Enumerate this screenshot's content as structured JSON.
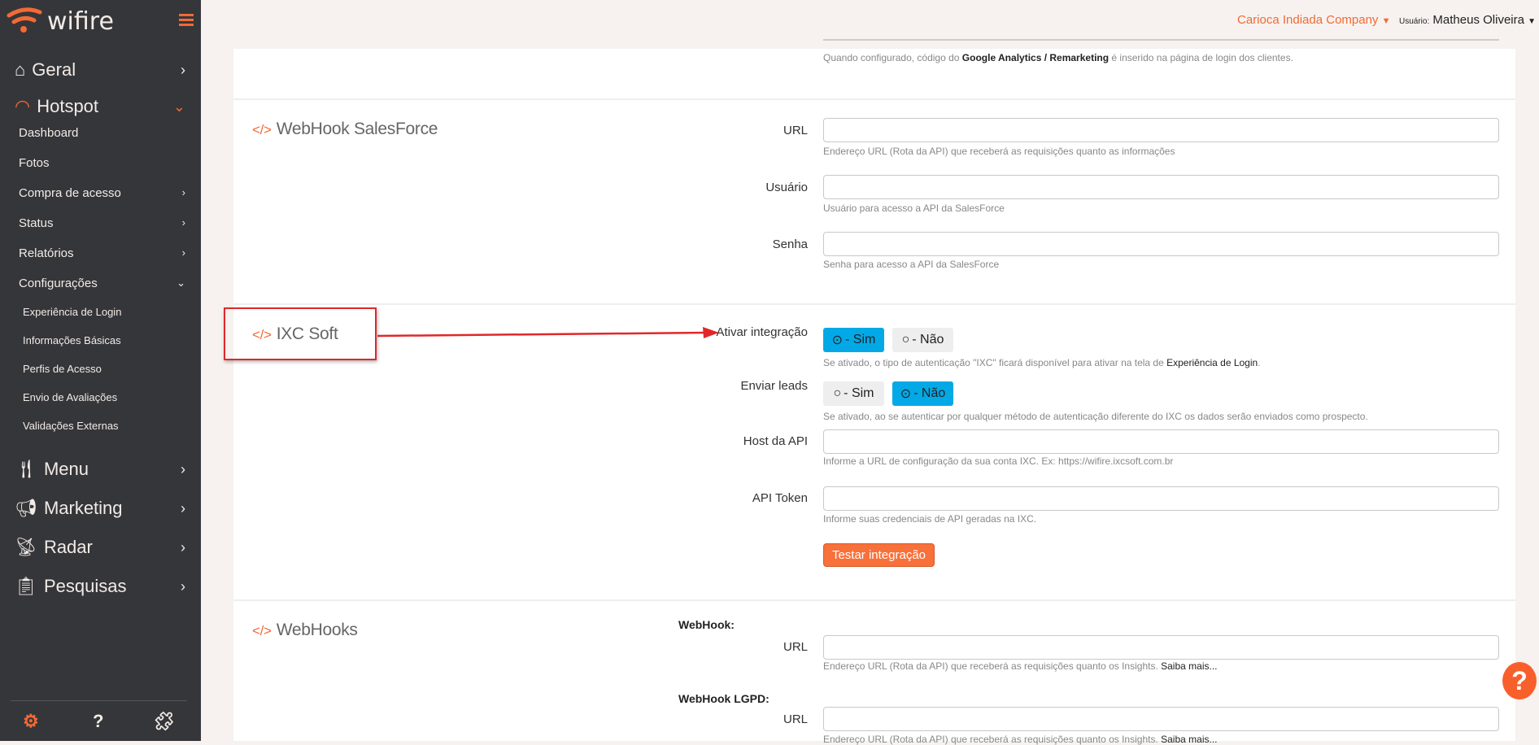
{
  "app": {
    "brand": "wifire"
  },
  "sidebar": {
    "main_items": [
      {
        "label": "Geral"
      },
      {
        "label": "Hotspot"
      },
      {
        "label": "Menu"
      },
      {
        "label": "Marketing"
      },
      {
        "label": "Radar"
      },
      {
        "label": "Pesquisas"
      }
    ],
    "hotspot_items": [
      {
        "label": "Dashboard"
      },
      {
        "label": "Fotos"
      },
      {
        "label": "Compra de acesso"
      },
      {
        "label": "Status"
      },
      {
        "label": "Relatórios"
      },
      {
        "label": "Configurações"
      }
    ],
    "config_items": [
      {
        "label": "Experiência de Login"
      },
      {
        "label": "Informações Básicas"
      },
      {
        "label": "Perfis de Acesso"
      },
      {
        "label": "Envio de Avaliações"
      },
      {
        "label": "Validações Externas"
      }
    ],
    "help_glyph": "?"
  },
  "header": {
    "company": "Carioca Indiada Company",
    "user_prefix": "Usuário:",
    "user_name": "Matheus Oliveira"
  },
  "analytics": {
    "hint_pre": "Quando configurado, código do ",
    "hint_bold": "Google Analytics / Remarketing",
    "hint_post": " é inserido na página de login dos clientes."
  },
  "salesforce": {
    "title": "WebHook SalesForce",
    "url_label": "URL",
    "url_hint": "Endereço URL (Rota da API) que receberá as requisições quanto as informações",
    "user_label": "Usuário",
    "user_hint": "Usuário para acesso a API da SalesForce",
    "pass_label": "Senha",
    "pass_hint": "Senha para acesso a API da SalesForce"
  },
  "ixc": {
    "title": "IXC Soft",
    "ativar_label": "Ativar integração",
    "sim": "- Sim",
    "nao": "- Não",
    "ativar_value": "Sim",
    "ativar_hint_pre": "Se ativado, o tipo de autenticação \"IXC\" ficará disponível para ativar na tela de ",
    "ativar_hint_link": "Experiência de Login",
    "ativar_hint_post": ".",
    "leads_label": "Enviar leads",
    "leads_value": "Não",
    "leads_hint": "Se ativado, ao se autenticar por qualquer método de autenticação diferente do IXC os dados serão enviados como prospecto.",
    "host_label": "Host da API",
    "host_hint": "Informe a URL de configuração da sua conta IXC. Ex: https://wifire.ixcsoft.com.br",
    "token_label": "API Token",
    "token_hint": "Informe suas credenciais de API geradas na IXC.",
    "test_button": "Testar integração"
  },
  "webhooks": {
    "title": "WebHooks",
    "webhook_label": "WebHook:",
    "url_label": "URL",
    "hint": "Endereço URL (Rota da API) que receberá as requisições quanto os Insights. ",
    "saiba": "Saiba mais...",
    "lgpd_label": "WebHook LGPD:"
  },
  "colors": {
    "accent": "#f26a35",
    "toggle_on": "#03a9e6",
    "sidebar": "#35363a"
  }
}
